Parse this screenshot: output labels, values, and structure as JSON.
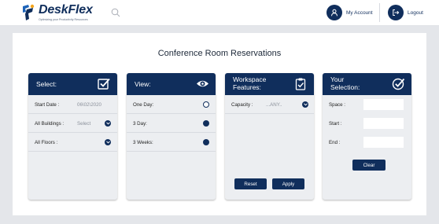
{
  "brand": {
    "name": "DeskFlex",
    "tagline": "Optimizing your Productivity Resources",
    "accent": "#102e5c"
  },
  "header": {
    "account_label": "My Account",
    "logout_label": "Logout"
  },
  "page": {
    "title": "Conference Room Reservations"
  },
  "select_card": {
    "title": "Select:",
    "icon": "checkbox-icon",
    "start_date_label": "Start Date :",
    "start_date_value": "06\\02\\2020",
    "buildings_label": "All Buildings :",
    "buildings_value": "Select",
    "floors_label": "All Floors :"
  },
  "view_card": {
    "title": "View:",
    "icon": "eye-icon",
    "options": [
      {
        "label": "One Day:",
        "selected": true
      },
      {
        "label": "3 Day:",
        "selected": false
      },
      {
        "label": "3 Weeks:",
        "selected": false
      }
    ]
  },
  "features_card": {
    "title_line1": "Workspace",
    "title_line2": "Features:",
    "icon": "clipboard-check-icon",
    "capacity_label": "Capacity :",
    "capacity_value": "...ANY..",
    "reset_label": "Reset",
    "apply_label": "Apply"
  },
  "selection_card": {
    "title_line1": "Your",
    "title_line2": "Selection:",
    "icon": "check-circle-icon",
    "space_label": "Space :",
    "start_label": "Start :",
    "end_label": "End :",
    "clear_label": "Clear"
  }
}
